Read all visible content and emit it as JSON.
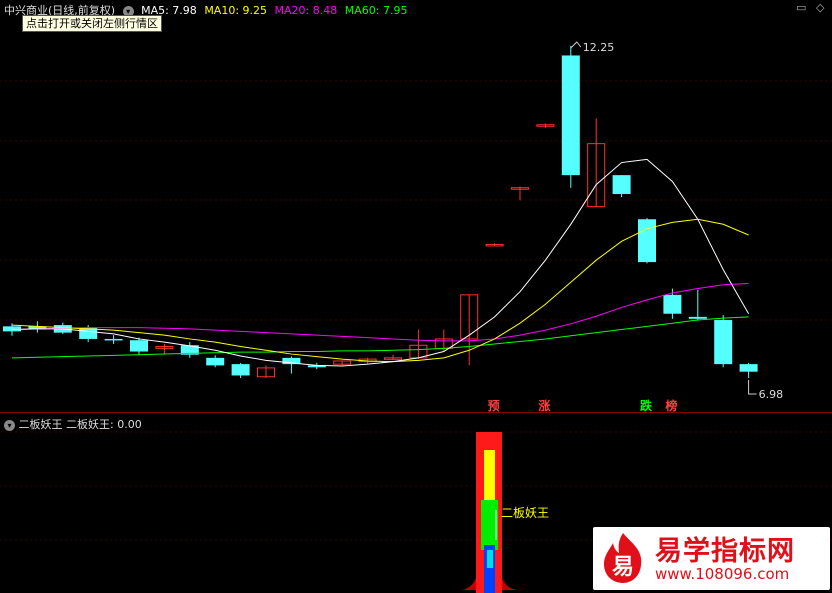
{
  "header": {
    "stock_title": "中兴商业(日线,前复权)",
    "ma": [
      {
        "label": "MA5: 7.98",
        "color": "#ffffff"
      },
      {
        "label": "MA10: 9.25",
        "color": "#ffff00"
      },
      {
        "label": "MA20: 8.48",
        "color": "#ff00ff"
      },
      {
        "label": "MA60: 7.95",
        "color": "#00ff00"
      }
    ],
    "tooltip": "点击打开或关闭左侧行情区"
  },
  "price_labels": {
    "high": "12.25",
    "low": "6.98"
  },
  "signals": [
    {
      "text": "预",
      "color": "#ff4040"
    },
    {
      "text": "涨",
      "color": "#ff4040"
    },
    {
      "text": "跌",
      "color": "#00ff00"
    },
    {
      "text": "榜",
      "color": "#ff4040"
    }
  ],
  "indicator": {
    "header": "二板妖王  二板妖王: 0.00",
    "bar_label": "二板妖王"
  },
  "watermark": {
    "logo_char": "易",
    "title": "易学指标网",
    "url": "www.108096.com"
  },
  "colors": {
    "up": "#ff3030",
    "down": "#55ffff",
    "bg": "#000000"
  },
  "chart_data": {
    "type": "candlestick",
    "candles": [
      {
        "o": 7.8,
        "h": 7.85,
        "l": 7.65,
        "c": 7.72
      },
      {
        "o": 7.8,
        "h": 7.88,
        "l": 7.7,
        "c": 7.75
      },
      {
        "o": 7.82,
        "h": 7.86,
        "l": 7.68,
        "c": 7.7
      },
      {
        "o": 7.78,
        "h": 7.82,
        "l": 7.55,
        "c": 7.6
      },
      {
        "o": 7.6,
        "h": 7.66,
        "l": 7.52,
        "c": 7.58
      },
      {
        "o": 7.58,
        "h": 7.62,
        "l": 7.35,
        "c": 7.4
      },
      {
        "o": 7.45,
        "h": 7.52,
        "l": 7.35,
        "c": 7.48
      },
      {
        "o": 7.5,
        "h": 7.55,
        "l": 7.3,
        "c": 7.35
      },
      {
        "o": 7.3,
        "h": 7.34,
        "l": 7.15,
        "c": 7.18
      },
      {
        "o": 7.2,
        "h": 7.22,
        "l": 6.98,
        "c": 7.02
      },
      {
        "o": 7.0,
        "h": 7.18,
        "l": 6.98,
        "c": 7.14
      },
      {
        "o": 7.3,
        "h": 7.32,
        "l": 7.05,
        "c": 7.2
      },
      {
        "o": 7.18,
        "h": 7.22,
        "l": 7.12,
        "c": 7.15
      },
      {
        "o": 7.2,
        "h": 7.26,
        "l": 7.18,
        "c": 7.25
      },
      {
        "o": 7.24,
        "h": 7.3,
        "l": 7.2,
        "c": 7.28
      },
      {
        "o": 7.28,
        "h": 7.35,
        "l": 7.26,
        "c": 7.3
      },
      {
        "o": 7.3,
        "h": 7.75,
        "l": 7.28,
        "c": 7.5
      },
      {
        "o": 7.45,
        "h": 7.75,
        "l": 7.4,
        "c": 7.6
      },
      {
        "o": 7.6,
        "h": 8.3,
        "l": 7.18,
        "c": 8.3
      },
      {
        "o": 9.1,
        "h": 9.12,
        "l": 9.08,
        "c": 9.1
      },
      {
        "o": 10.0,
        "h": 10.02,
        "l": 9.8,
        "c": 10.0
      },
      {
        "o": 11.0,
        "h": 11.02,
        "l": 10.95,
        "c": 11.0
      },
      {
        "o": 12.1,
        "h": 12.25,
        "l": 10.0,
        "c": 10.2
      },
      {
        "o": 9.7,
        "h": 11.1,
        "l": 9.7,
        "c": 10.7
      },
      {
        "o": 10.2,
        "h": 10.2,
        "l": 9.85,
        "c": 9.9
      },
      {
        "o": 9.5,
        "h": 9.52,
        "l": 8.8,
        "c": 8.82
      },
      {
        "o": 8.3,
        "h": 8.4,
        "l": 7.92,
        "c": 8.0
      },
      {
        "o": 7.95,
        "h": 8.38,
        "l": 7.9,
        "c": 7.92
      },
      {
        "o": 7.9,
        "h": 7.98,
        "l": 7.15,
        "c": 7.2
      },
      {
        "o": 7.2,
        "h": 7.22,
        "l": 6.98,
        "c": 7.08
      }
    ],
    "ma5": [
      7.75,
      7.76,
      7.76,
      7.72,
      7.68,
      7.6,
      7.55,
      7.49,
      7.42,
      7.33,
      7.26,
      7.22,
      7.18,
      7.17,
      7.2,
      7.24,
      7.3,
      7.4,
      7.66,
      7.95,
      8.35,
      8.85,
      9.42,
      10.05,
      10.4,
      10.45,
      10.1,
      9.5,
      8.7,
      8.0
    ],
    "ma10": [
      7.82,
      7.8,
      7.78,
      7.76,
      7.74,
      7.7,
      7.66,
      7.6,
      7.55,
      7.48,
      7.42,
      7.36,
      7.32,
      7.28,
      7.25,
      7.24,
      7.26,
      7.3,
      7.42,
      7.6,
      7.85,
      8.15,
      8.5,
      8.85,
      9.15,
      9.35,
      9.45,
      9.5,
      9.42,
      9.25
    ],
    "ma20": [
      7.75,
      7.76,
      7.77,
      7.78,
      7.78,
      7.78,
      7.77,
      7.76,
      7.74,
      7.72,
      7.7,
      7.68,
      7.66,
      7.64,
      7.62,
      7.6,
      7.58,
      7.57,
      7.57,
      7.6,
      7.66,
      7.74,
      7.84,
      7.96,
      8.1,
      8.22,
      8.33,
      8.4,
      8.46,
      8.48
    ],
    "ma60": [
      7.3,
      7.31,
      7.32,
      7.33,
      7.34,
      7.35,
      7.36,
      7.37,
      7.38,
      7.39,
      7.39,
      7.4,
      7.4,
      7.41,
      7.41,
      7.42,
      7.43,
      7.45,
      7.48,
      7.52,
      7.56,
      7.6,
      7.65,
      7.7,
      7.75,
      7.8,
      7.85,
      7.9,
      7.93,
      7.95
    ]
  }
}
